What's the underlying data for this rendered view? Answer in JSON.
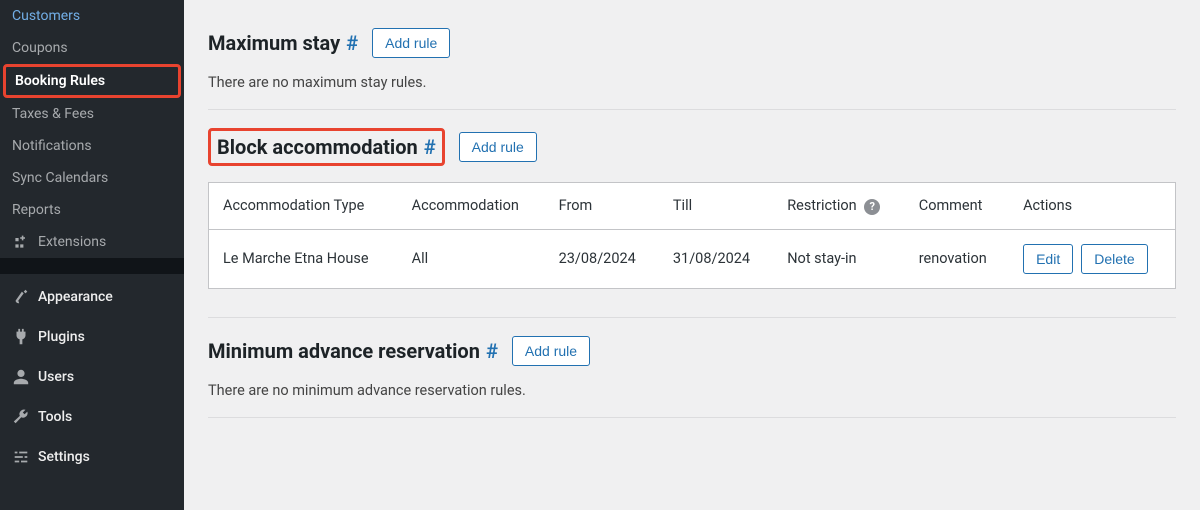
{
  "sidebar": {
    "items": [
      {
        "label": "Customers",
        "active": false
      },
      {
        "label": "Coupons",
        "active": false
      },
      {
        "label": "Booking Rules",
        "active": true,
        "highlighted": true
      },
      {
        "label": "Taxes & Fees",
        "active": false
      },
      {
        "label": "Notifications",
        "active": false
      },
      {
        "label": "Sync Calendars",
        "active": false
      },
      {
        "label": "Reports",
        "active": false
      },
      {
        "label": "Extensions",
        "active": false,
        "icon": "extensions-icon"
      }
    ],
    "admin_items": [
      {
        "label": "Appearance",
        "icon": "brush-icon"
      },
      {
        "label": "Plugins",
        "icon": "plug-icon"
      },
      {
        "label": "Users",
        "icon": "user-icon"
      },
      {
        "label": "Tools",
        "icon": "wrench-icon"
      },
      {
        "label": "Settings",
        "icon": "sliders-icon"
      }
    ]
  },
  "sections": {
    "max_stay": {
      "title": "Maximum stay",
      "add_rule_label": "Add rule",
      "empty_text": "There are no maximum stay rules."
    },
    "block_accom": {
      "title": "Block accommodation",
      "add_rule_label": "Add rule",
      "highlighted": true,
      "columns": {
        "accom_type": "Accommodation Type",
        "accom": "Accommodation",
        "from": "From",
        "till": "Till",
        "restriction": "Restriction",
        "comment": "Comment",
        "actions": "Actions"
      },
      "rows": [
        {
          "accom_type": "Le Marche Etna House",
          "accom": "All",
          "from": "23/08/2024",
          "till": "31/08/2024",
          "restriction": "Not stay-in",
          "comment": "renovation",
          "edit_label": "Edit",
          "delete_label": "Delete"
        }
      ]
    },
    "min_advance": {
      "title": "Minimum advance reservation",
      "add_rule_label": "Add rule",
      "empty_text": "There are no minimum advance reservation rules."
    }
  }
}
